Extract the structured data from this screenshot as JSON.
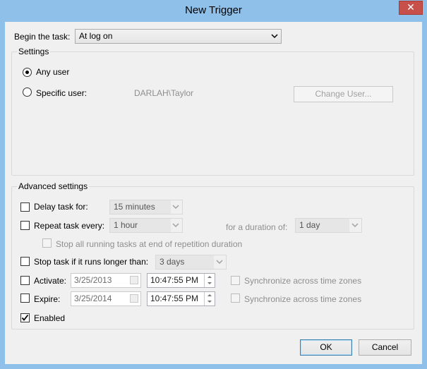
{
  "window": {
    "title": "New Trigger",
    "close_glyph": "✕"
  },
  "begin": {
    "label": "Begin the task:",
    "value": "At log on"
  },
  "settings": {
    "legend": "Settings",
    "any_user": "Any user",
    "specific_user": "Specific user:",
    "user_value": "DARLAH\\Taylor",
    "change_user_button": "Change User..."
  },
  "advanced": {
    "legend": "Advanced settings",
    "delay_label": "Delay task for:",
    "delay_value": "15 minutes",
    "repeat_label": "Repeat task every:",
    "repeat_value": "1 hour",
    "duration_label": "for a duration of:",
    "duration_value": "1 day",
    "stop_running_label": "Stop all running tasks at end of repetition duration",
    "stop_if_longer_label": "Stop task if it runs longer than:",
    "stop_if_longer_value": "3 days",
    "activate_label": "Activate:",
    "activate_date": "3/25/2013",
    "activate_time": "10:47:55 PM",
    "expire_label": "Expire:",
    "expire_date": "3/25/2014",
    "expire_time": "10:47:55 PM",
    "sync_label": "Synchronize across time zones",
    "enabled_label": "Enabled"
  },
  "buttons": {
    "ok": "OK",
    "cancel": "Cancel"
  },
  "colors": {
    "frame": "#8ec0ea",
    "close": "#c7504a",
    "client": "#f0f0f0"
  }
}
